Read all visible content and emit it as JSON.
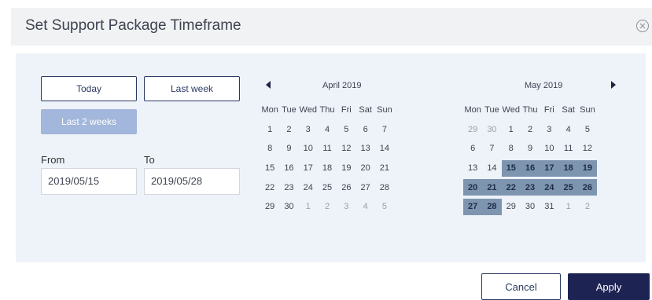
{
  "dialog": {
    "title": "Set Support Package Timeframe",
    "close_icon": "close-circle-icon"
  },
  "quick_ranges": {
    "today": "Today",
    "last_week": "Last week",
    "last_2_weeks": "Last 2 weeks"
  },
  "range": {
    "from_label": "From",
    "from_value": "2019/05/15",
    "to_label": "To",
    "to_value": "2019/05/28"
  },
  "weekdays": [
    "Mon",
    "Tue",
    "Wed",
    "Thu",
    "Fri",
    "Sat",
    "Sun"
  ],
  "calendars": [
    {
      "month": "April 2019",
      "weeks": [
        [
          "1",
          "2",
          "3",
          "4",
          "5",
          "6",
          "7"
        ],
        [
          "8",
          "9",
          "10",
          "11",
          "12",
          "13",
          "14"
        ],
        [
          "15",
          "16",
          "17",
          "18",
          "19",
          "20",
          "21"
        ],
        [
          "22",
          "23",
          "24",
          "25",
          "26",
          "27",
          "28"
        ],
        [
          "29",
          "30",
          "1",
          "2",
          "3",
          "4",
          "5"
        ]
      ],
      "muted": [
        [
          4,
          2
        ],
        [
          4,
          3
        ],
        [
          4,
          4
        ],
        [
          4,
          5
        ],
        [
          4,
          6
        ]
      ],
      "selected": []
    },
    {
      "month": "May 2019",
      "weeks": [
        [
          "29",
          "30",
          "1",
          "2",
          "3",
          "4",
          "5"
        ],
        [
          "6",
          "7",
          "8",
          "9",
          "10",
          "11",
          "12"
        ],
        [
          "13",
          "14",
          "15",
          "16",
          "17",
          "18",
          "19"
        ],
        [
          "20",
          "21",
          "22",
          "23",
          "24",
          "25",
          "26"
        ],
        [
          "27",
          "28",
          "29",
          "30",
          "31",
          "1",
          "2"
        ]
      ],
      "muted": [
        [
          0,
          0
        ],
        [
          0,
          1
        ],
        [
          4,
          5
        ],
        [
          4,
          6
        ]
      ],
      "selected": [
        [
          2,
          2
        ],
        [
          2,
          3
        ],
        [
          2,
          4
        ],
        [
          2,
          5
        ],
        [
          2,
          6
        ],
        [
          3,
          0
        ],
        [
          3,
          1
        ],
        [
          3,
          2
        ],
        [
          3,
          3
        ],
        [
          3,
          4
        ],
        [
          3,
          5
        ],
        [
          3,
          6
        ],
        [
          4,
          0
        ],
        [
          4,
          1
        ]
      ]
    }
  ],
  "footer": {
    "cancel": "Cancel",
    "apply": "Apply"
  },
  "colors": {
    "accent": "#1d2453",
    "selected": "#7e95b0",
    "panel": "#eef2f9"
  }
}
